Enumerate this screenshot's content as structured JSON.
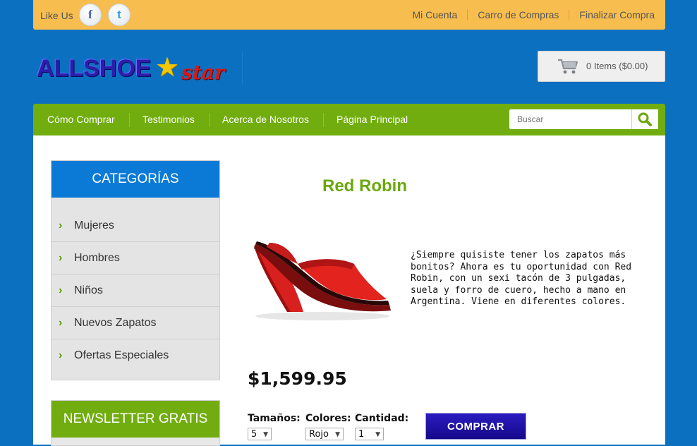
{
  "topbar": {
    "like_us": "Like Us",
    "facebook_icon": "facebook-icon",
    "twitter_icon": "twitter-icon",
    "links": [
      "Mi Cuenta",
      "Carro de Compras",
      "Finalizar Compra"
    ]
  },
  "brand": {
    "logo_main": "ALLSHOE",
    "logo_sub": "star"
  },
  "cart": {
    "icon": "shopping-cart-icon",
    "summary": "0 Items ($0.00)"
  },
  "nav": {
    "items": [
      "Cómo Comprar",
      "Testimonios",
      "Acerca de Nosotros",
      "Página Principal"
    ],
    "search_placeholder": "Buscar",
    "search_icon": "search-icon"
  },
  "sidebar": {
    "categories_title": "CATEGORÍAS",
    "categories": [
      "Mujeres",
      "Hombres",
      "Niños",
      "Nuevos Zapatos",
      "Ofertas Especiales"
    ],
    "newsletter_title": "NEWSLETTER GRATIS"
  },
  "product": {
    "name": "Red Robin",
    "description": "¿Siempre quisiste tener los zapatos más bonitos? Ahora es tu oportunidad con Red Robin, con un sexi tacón de 3 pulgadas, suela y forro de cuero, hecho a mano en Argentina. Viene en diferentes colores.",
    "price": "$1,599.95",
    "size_label": "Tamaños:",
    "size_value": "5",
    "color_label": "Colores:",
    "color_value": "Rojo",
    "qty_label": "Cantidad:",
    "qty_value": "1",
    "buy_label": "COMPRAR"
  },
  "colors": {
    "background": "#0b70c0",
    "topbar": "#f7bd4f",
    "nav": "#71ad0f",
    "category_header": "#0b7ad7",
    "product_title": "#6aa80d",
    "buy_button": "#1c0fa8"
  }
}
